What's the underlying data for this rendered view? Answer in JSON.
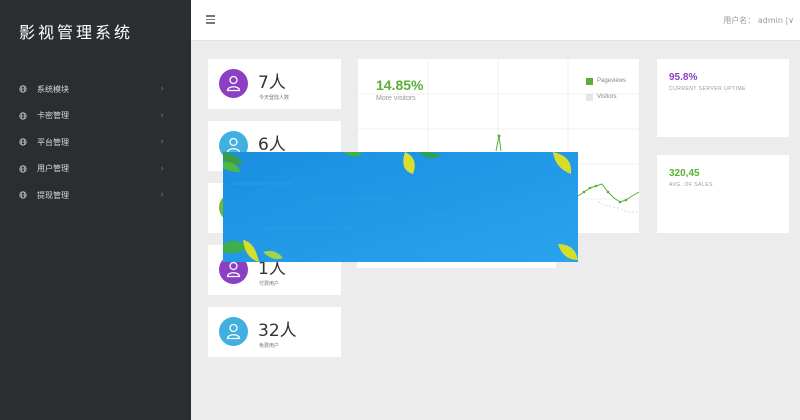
{
  "sidebar": {
    "brand": "影视管理系统",
    "items": [
      {
        "label": "系统模块",
        "icon": "globe-icon"
      },
      {
        "label": "卡密管理",
        "icon": "globe-icon"
      },
      {
        "label": "平台管理",
        "icon": "globe-icon"
      },
      {
        "label": "用户管理",
        "icon": "globe-icon"
      },
      {
        "label": "提现管理",
        "icon": "globe-icon"
      }
    ]
  },
  "topbar": {
    "menu_icon": "hamburger-icon",
    "user_label": "用户名： admin  |∨"
  },
  "stats": [
    {
      "value": "7人",
      "label": "今天登陆人数",
      "color": "#8b3fc2"
    },
    {
      "value": "6人",
      "label": "",
      "color": "#3fb0e0"
    },
    {
      "value": "",
      "label": "",
      "color": "#6bb83a"
    },
    {
      "value": "1人",
      "label": "付费用户",
      "color": "#8b3fc2"
    },
    {
      "value": "32人",
      "label": "免费用户",
      "color": "#3fb0e0"
    }
  ],
  "chart_panel": {
    "percent": "14.85%",
    "subtitle": "More visitors",
    "legend": [
      {
        "name": "Pageviews",
        "color": "#5ab136"
      },
      {
        "name": "Visitors",
        "color": "#e6e6e6"
      }
    ]
  },
  "right_cards": [
    {
      "value": "95.8%",
      "label": "CURRENT SERVER UPTIME",
      "color": "#8b3fc2"
    },
    {
      "value": "320,45",
      "label": "AVG. OF SALES",
      "color": "#5ab136"
    }
  ],
  "colors": {
    "sidebar_bg": "#2b2e31",
    "page_bg": "#ececec",
    "banner_bg": "#1e98e6",
    "accent_green": "#5ab136",
    "accent_purple": "#8b3fc2"
  }
}
